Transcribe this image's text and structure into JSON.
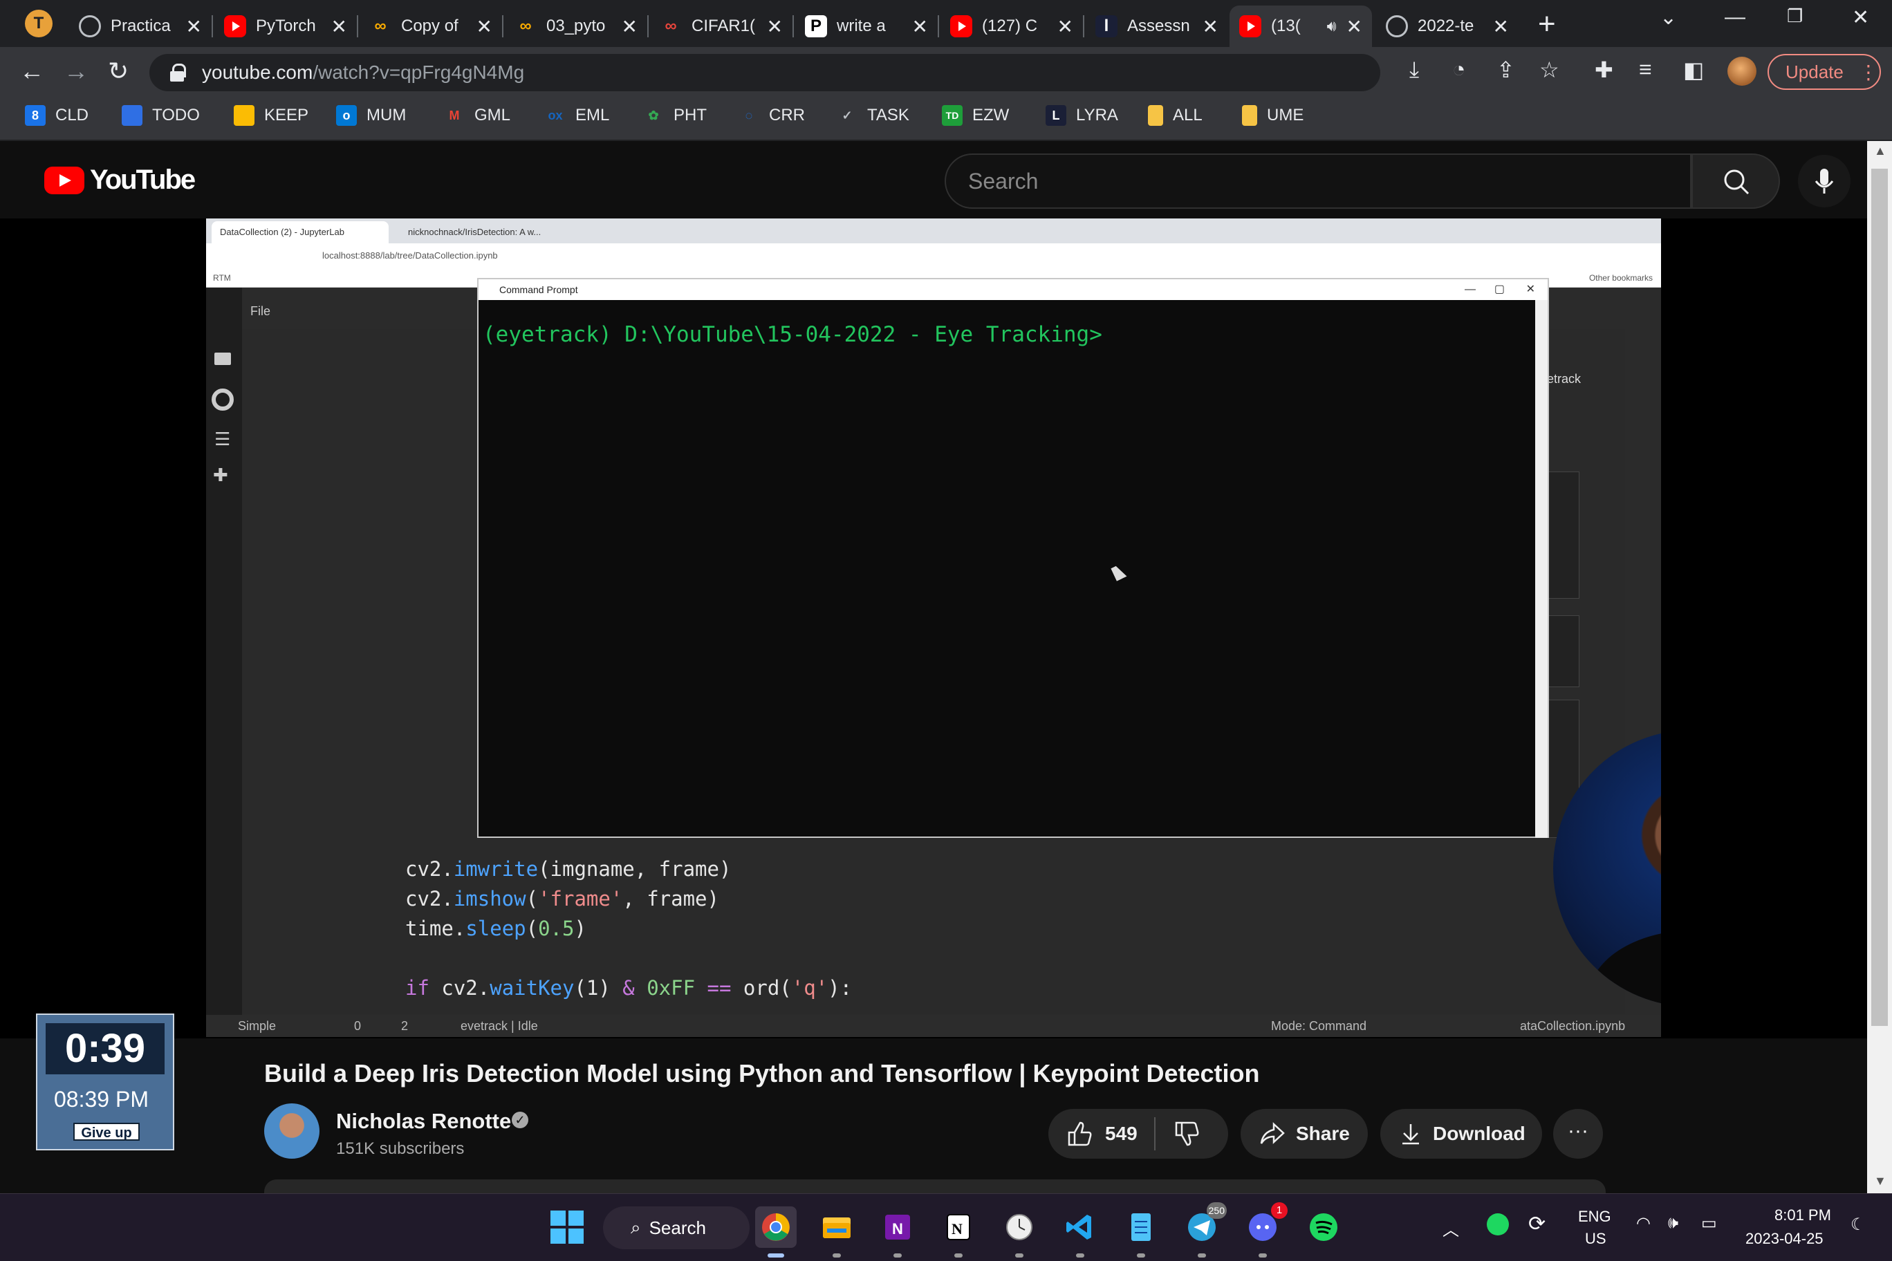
{
  "browser": {
    "profile_initial": "T",
    "tabs": [
      {
        "label": "Practica",
        "icon": "globe-icon"
      },
      {
        "label": "PyTorch",
        "icon": "youtube-icon"
      },
      {
        "label": "Copy of",
        "icon": "colab-icon"
      },
      {
        "label": "03_pyto",
        "icon": "colab-icon"
      },
      {
        "label": "CIFAR1(",
        "icon": "colab-icon"
      },
      {
        "label": "write a",
        "icon": "perplexity-icon"
      },
      {
        "label": "(127) C",
        "icon": "youtube-icon"
      },
      {
        "label": "Assessn",
        "icon": "lyra-icon"
      },
      {
        "label": "(13(",
        "icon": "youtube-icon",
        "active": true
      },
      {
        "label": "2022-te",
        "icon": "globe-icon"
      }
    ],
    "url_host": "youtube.com",
    "url_path": "/watch?v=qpFrg4gN4Mg",
    "update_label": "Update",
    "bookmarks": [
      {
        "label": "CLD",
        "color": "#1a73e8",
        "glyph": "8"
      },
      {
        "label": "TODO",
        "color": "#2f6fe4",
        "glyph": ""
      },
      {
        "label": "KEEP",
        "color": "#fbbc04",
        "glyph": ""
      },
      {
        "label": "MUM",
        "color": "#0078d4",
        "glyph": "o"
      },
      {
        "label": "GML",
        "color": "#ea4335",
        "glyph": "M"
      },
      {
        "label": "EML",
        "color": "#1565c0",
        "glyph": "ox"
      },
      {
        "label": "PHT",
        "color": "#34a853",
        "glyph": "✿"
      },
      {
        "label": "CRR",
        "color": "#1a73e8",
        "glyph": "◌"
      },
      {
        "label": "TASK",
        "color": "#5f6368",
        "glyph": "✓"
      },
      {
        "label": "EZW",
        "color": "#1e9e3a",
        "glyph": "TD"
      },
      {
        "label": "LYRA",
        "color": "#1a1f36",
        "glyph": "L"
      },
      {
        "label": "ALL",
        "color": "#f6c445",
        "glyph": ""
      },
      {
        "label": "UME",
        "color": "#f6c445",
        "glyph": ""
      }
    ]
  },
  "youtube": {
    "logo_text": "YouTube",
    "search_placeholder": "Search"
  },
  "video_frame": {
    "inner_tabs": [
      "DataCollection (2) - JupyterLab",
      "nicknochnack/IrisDetection: A w..."
    ],
    "inner_url": "localhost:8888/lab/tree/DataCollection.ipynb",
    "other_bookmarks": "Other bookmarks",
    "rtm_label": "RTM",
    "file_menu": "File",
    "kernel_name": "eyetrack",
    "cmd_title": "Command Prompt",
    "prompt_text": "(eyetrack) D:\\YouTube\\15-04-2022 - Eye Tracking>",
    "code_lines": {
      "l1_obj": "cv2.",
      "l1_fn": "imwrite",
      "l1_rest": "(imgname, frame)",
      "l2_obj": "cv2.",
      "l2_fn": "imshow",
      "l2_open": "(",
      "l2_str": "'frame'",
      "l2_rest": ", frame)",
      "l3_obj": "time.",
      "l3_fn": "sleep",
      "l3_open": "(",
      "l3_num": "0.5",
      "l3_close": ")",
      "l4_kw": "if",
      "l4_a": " cv2.",
      "l4_fn": "waitKey",
      "l4_b": "(1) ",
      "l4_amp": "&",
      "l4_hex": " 0xFF ",
      "l4_eq": "==",
      "l4_ord": " ord(",
      "l4_str": "'q'",
      "l4_end": "):"
    },
    "status_simple": "Simple",
    "status_counts": "0",
    "status_counts2": "2",
    "status_kernel": "evetrack | Idle",
    "status_mode": "Mode: Command",
    "status_file": "ataCollection.ipynb"
  },
  "timer_widget": {
    "elapsed": "0:39",
    "clock": "08:39 PM",
    "give_up": "Give up"
  },
  "video": {
    "title": "Build a Deep Iris Detection Model using Python and Tensorflow | Keypoint Detection",
    "channel_name": "Nicholas Renotte",
    "subscribers": "151K subscribers",
    "likes": "549",
    "share_label": "Share",
    "download_label": "Download",
    "more_label": "···"
  },
  "taskbar": {
    "search_label": "Search",
    "telegram_badge": "250",
    "discord_badge": "1",
    "lang_line1": "ENG",
    "lang_line2": "US",
    "time": "8:01 PM",
    "date": "2023-04-25"
  }
}
